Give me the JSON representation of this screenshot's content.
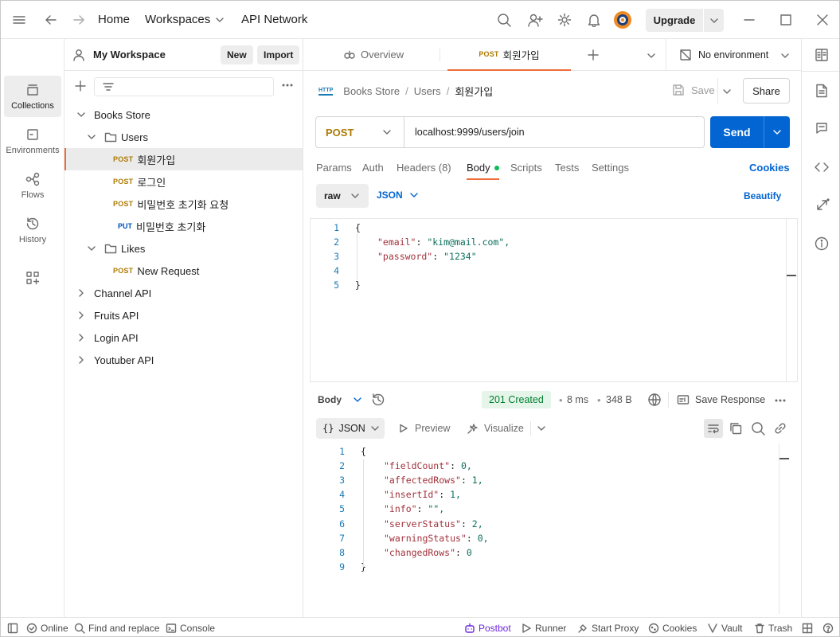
{
  "titlebar": {
    "nav": [
      "Home",
      "Workspaces",
      "API Network"
    ],
    "upgrade_label": "Upgrade"
  },
  "workspace": {
    "name": "My Workspace",
    "new_label": "New",
    "import_label": "Import"
  },
  "rail": [
    {
      "label": "Collections",
      "icon": "collections-icon"
    },
    {
      "label": "Environments",
      "icon": "environments-icon"
    },
    {
      "label": "Flows",
      "icon": "flows-icon"
    },
    {
      "label": "History",
      "icon": "history-icon"
    }
  ],
  "tree": {
    "collection": "Books Store",
    "folder_users": "Users",
    "requests_users": [
      {
        "method": "POST",
        "name": "회원가입"
      },
      {
        "method": "POST",
        "name": "로그인"
      },
      {
        "method": "POST",
        "name": "비밀번호 초기화 요청"
      },
      {
        "method": "PUT",
        "name": "비밀번호 초기화"
      }
    ],
    "folder_likes": "Likes",
    "requests_likes": [
      {
        "method": "POST",
        "name": "New Request"
      }
    ],
    "other_collections": [
      "Channel API",
      "Fruits API",
      "Login API",
      "Youtuber API"
    ]
  },
  "tabs": {
    "overview": "Overview",
    "active_method": "POST",
    "active_name": "회원가입",
    "environment": "No environment"
  },
  "breadcrumb": {
    "icon_text": "HTTP",
    "parts": [
      "Books Store",
      "Users",
      "회원가입"
    ],
    "save_label": "Save",
    "share_label": "Share"
  },
  "request": {
    "method": "POST",
    "url": "localhost:9999/users/join",
    "send_label": "Send",
    "subtabs": [
      "Params",
      "Auth",
      "Headers (8)",
      "Body",
      "Scripts",
      "Tests",
      "Settings"
    ],
    "cookies_label": "Cookies",
    "body_mode": "raw",
    "body_format": "JSON",
    "beautify_label": "Beautify",
    "body_lines": [
      "{",
      "\"email\": \"kim@mail.com\",",
      "\"password\": \"1234\"",
      "",
      "}"
    ]
  },
  "response": {
    "body_label": "Body",
    "status": "201 Created",
    "time": "8 ms",
    "size": "348 B",
    "save_response_label": "Save Response",
    "format": "JSON",
    "preview_label": "Preview",
    "visualize_label": "Visualize",
    "lines": [
      {
        "n": "1",
        "k": "",
        "v": "{"
      },
      {
        "n": "2",
        "k": "\"fieldCount\"",
        "v": " 0,"
      },
      {
        "n": "3",
        "k": "\"affectedRows\"",
        "v": " 1,"
      },
      {
        "n": "4",
        "k": "\"insertId\"",
        "v": " 1,"
      },
      {
        "n": "5",
        "k": "\"info\"",
        "v": " \"\","
      },
      {
        "n": "6",
        "k": "\"serverStatus\"",
        "v": " 2,"
      },
      {
        "n": "7",
        "k": "\"warningStatus\"",
        "v": " 0,"
      },
      {
        "n": "8",
        "k": "\"changedRows\"",
        "v": " 0"
      },
      {
        "n": "9",
        "k": "",
        "v": "}"
      }
    ]
  },
  "statusbar": {
    "online": "Online",
    "find_replace": "Find and replace",
    "console": "Console",
    "postbot": "Postbot",
    "runner": "Runner",
    "start_proxy": "Start Proxy",
    "cookies": "Cookies",
    "vault": "Vault",
    "trash": "Trash"
  },
  "colors": {
    "send": "#0265d2",
    "accent": "#ef6c3a",
    "status_ok": "#007f31",
    "post": "#ad7a03",
    "put": "#0053b8"
  }
}
